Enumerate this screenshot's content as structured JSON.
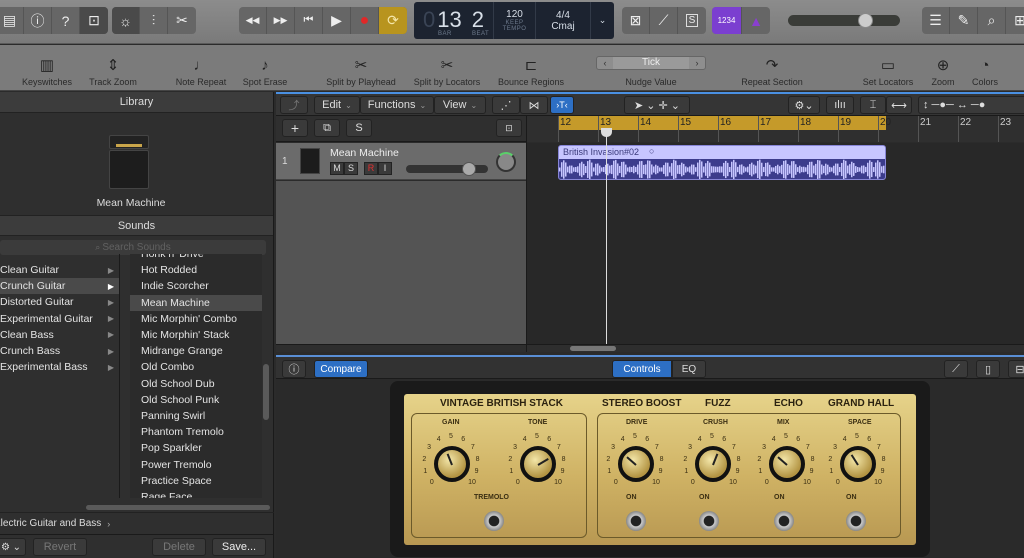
{
  "topbar": {
    "view_buttons": [
      "library-icon",
      "info-icon",
      "help-icon",
      "editors-icon"
    ],
    "view_glyphs": [
      "▤",
      "ⓘ",
      "?",
      "⊡"
    ],
    "edit_buttons": [
      "smart-controls-icon",
      "mixer-icon",
      "scissors-icon"
    ],
    "edit_glyphs": [
      "☼",
      "⫶",
      "✂"
    ],
    "transport": [
      "rewind",
      "fast-forward",
      "go-to-start",
      "play",
      "record",
      "cycle"
    ],
    "transport_glyphs": [
      "◀◀",
      "▶▶",
      "⏮",
      "▶",
      "●",
      "⟳"
    ],
    "lcd": {
      "bar_prefix": "0",
      "bar": "13",
      "beat": "2",
      "bar_label": "BAR",
      "beat_label": "BEAT",
      "tempo": "120",
      "tempo_mode": "KEEP",
      "tempo_label": "TEMPO",
      "time_signature": "4/4",
      "key": "Cmaj"
    },
    "mode_glyphs": [
      "⊠",
      "⟋",
      "S"
    ],
    "count_in": "1234",
    "metronome_glyph": "▲",
    "master_volume": 0.72,
    "right_glyphs": [
      "☰",
      "✎",
      "⌕",
      "⊞"
    ]
  },
  "toolbar": {
    "items": [
      {
        "label": "Keyswitches",
        "icon": "🎹"
      },
      {
        "label": "Track Zoom",
        "icon": "⇕"
      },
      {
        "label": "Note Repeat",
        "icon": "♩"
      },
      {
        "label": "Spot Erase",
        "icon": "♪"
      },
      {
        "label": "Split by Playhead",
        "icon": "✂"
      },
      {
        "label": "Split by Locators",
        "icon": "✂"
      },
      {
        "label": "Bounce Regions",
        "icon": "⊏"
      },
      {
        "label": "Nudge Value",
        "icon": ""
      },
      {
        "label": "Repeat Section",
        "icon": "↷"
      },
      {
        "label": "Set Locators",
        "icon": "▭"
      },
      {
        "label": "Zoom",
        "icon": "⊕"
      },
      {
        "label": "Colors",
        "icon": "◔"
      }
    ],
    "nudge_value": "Tick"
  },
  "library": {
    "title": "Library",
    "patch_name": "Mean Machine",
    "sounds_title": "Sounds",
    "search_placeholder": "Search Sounds",
    "categories": [
      {
        "label": "Clean Guitar",
        "selected": false
      },
      {
        "label": "Crunch Guitar",
        "selected": true
      },
      {
        "label": "Distorted Guitar",
        "selected": false
      },
      {
        "label": "Experimental Guitar",
        "selected": false
      },
      {
        "label": "Clean Bass",
        "selected": false
      },
      {
        "label": "Crunch Bass",
        "selected": false
      },
      {
        "label": "Experimental Bass",
        "selected": false
      }
    ],
    "patches": [
      {
        "label": "Honk n' Drive",
        "selected": false
      },
      {
        "label": "Hot Rodded",
        "selected": false
      },
      {
        "label": "Indie Scorcher",
        "selected": false
      },
      {
        "label": "Mean Machine",
        "selected": true
      },
      {
        "label": "Mic Morphin' Combo",
        "selected": false
      },
      {
        "label": "Mic Morphin' Stack",
        "selected": false
      },
      {
        "label": "Midrange Grange",
        "selected": false
      },
      {
        "label": "Old Combo",
        "selected": false
      },
      {
        "label": "Old School Dub",
        "selected": false
      },
      {
        "label": "Old School Punk",
        "selected": false
      },
      {
        "label": "Panning Swirl",
        "selected": false
      },
      {
        "label": "Phantom Tremolo",
        "selected": false
      },
      {
        "label": "Pop Sparkler",
        "selected": false
      },
      {
        "label": "Power Tremolo",
        "selected": false
      },
      {
        "label": "Practice Space",
        "selected": false
      },
      {
        "label": "Rage Face",
        "selected": false
      }
    ],
    "breadcrumb": "Electric Guitar and Bass",
    "revert_label": "Revert",
    "delete_label": "Delete",
    "save_label": "Save..."
  },
  "tracks": {
    "menus": [
      "Edit",
      "Functions",
      "View"
    ],
    "add_label": "+",
    "solo_label": "S",
    "track": {
      "number": "1",
      "name": "Mean Machine",
      "mute": "M",
      "solo": "S",
      "record": "R",
      "input": "I",
      "volume": 0.82
    },
    "ruler": [
      "12",
      "13",
      "14",
      "15",
      "16",
      "17",
      "18",
      "19",
      "20",
      "21",
      "22",
      "23"
    ],
    "region_name": "British Invasion#02",
    "playhead_bar": 13.2
  },
  "smart": {
    "compare_label": "Compare",
    "tabs": [
      {
        "label": "Controls",
        "active": true
      },
      {
        "label": "EQ",
        "active": false
      }
    ],
    "sections": [
      "VINTAGE BRITISH STACK",
      "STEREO BOOST",
      "FUZZ",
      "ECHO",
      "GRAND HALL"
    ],
    "knobs": [
      {
        "label": "GAIN",
        "value": 4.2
      },
      {
        "label": "TONE",
        "value": 7.2
      },
      {
        "label": "DRIVE",
        "value": 3.2
      },
      {
        "label": "CRUSH",
        "value": 5.8
      },
      {
        "label": "MIX",
        "value": 3.2
      },
      {
        "label": "SPACE",
        "value": 3.8
      }
    ],
    "switches": [
      {
        "label": "TREMOLO",
        "on": false
      },
      {
        "label": "ON",
        "on": true
      },
      {
        "label": "ON",
        "on": false
      },
      {
        "label": "ON",
        "on": false
      },
      {
        "label": "ON",
        "on": false
      }
    ],
    "scale": [
      "0",
      "1",
      "2",
      "3",
      "4",
      "5",
      "6",
      "7",
      "8",
      "9",
      "10"
    ]
  }
}
